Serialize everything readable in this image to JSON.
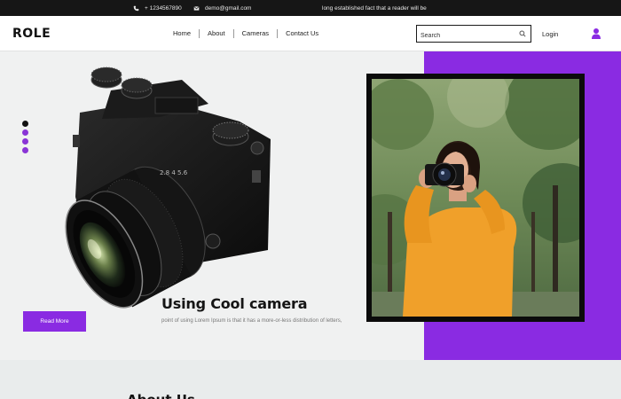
{
  "topbar": {
    "phone": "+ 1234567890",
    "email": "demo@gmail.com",
    "tagline": "long established fact that a reader will be"
  },
  "header": {
    "logo": "ROLE",
    "nav": [
      "Home",
      "About",
      "Cameras",
      "Contact Us"
    ],
    "search_placeholder": "Search",
    "login": "Login"
  },
  "hero": {
    "title": "Using Cool camera",
    "description": "point of using Lorem Ipsum is that it has a more-or-less distribution of letters,",
    "button": "Read More",
    "slider_dots": 4,
    "active_dot": 0
  },
  "about": {
    "title": "About Us"
  },
  "colors": {
    "accent": "#8a2be2",
    "topbar": "#161616",
    "frame": "#0b0b0b"
  },
  "icons": [
    "phone-icon",
    "mail-icon",
    "search-icon",
    "user-icon"
  ]
}
